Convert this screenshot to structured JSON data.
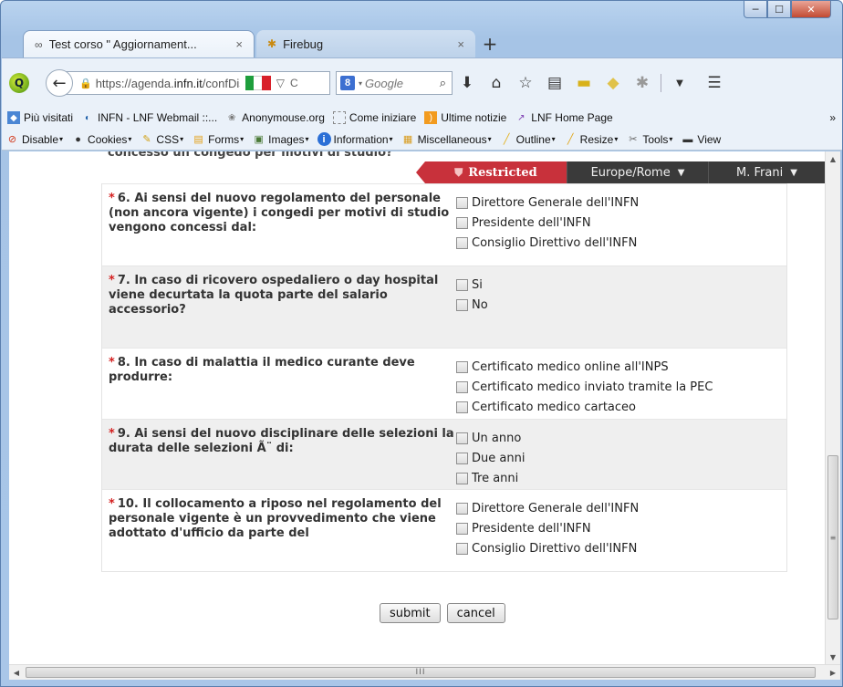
{
  "window": {
    "controls": {
      "minimize": "─",
      "maximize": "☐",
      "close": "✕"
    }
  },
  "tabs": [
    {
      "title": "Test corso \" Aggiornament...",
      "close": "×",
      "icon": "infinity-icon"
    },
    {
      "title": "Firebug",
      "close": "×",
      "icon": "firebug-icon"
    }
  ],
  "new_tab": "+",
  "navbar": {
    "url_prefix": "https://agenda.",
    "url_domain": "infn.it",
    "url_suffix": "/confDispla",
    "flag_colors": [
      "#1e9e3c",
      "#ffffff",
      "#d8202a"
    ],
    "search_engine": "8",
    "search_placeholder": "Google",
    "search_glyph": "⌕",
    "back": "←"
  },
  "bookmarks": [
    {
      "label": "Più visitati",
      "icon": "most-visited-icon"
    },
    {
      "label": "INFN - LNF Webmail ::...",
      "icon": "webmail-icon"
    },
    {
      "label": "Anonymouse.org",
      "icon": "anonymouse-icon"
    },
    {
      "label": "Come iniziare",
      "icon": "page-icon"
    },
    {
      "label": "Ultime notizie",
      "icon": "rss-icon"
    },
    {
      "label": "LNF Home Page",
      "icon": "lnf-icon"
    }
  ],
  "bookmarks_more": "»",
  "devbar": [
    {
      "label": "Disable",
      "color": "#d23a1d",
      "glyph": "⊘"
    },
    {
      "label": "Cookies",
      "color": "#333333",
      "glyph": "●"
    },
    {
      "label": "CSS",
      "color": "#e2b21c",
      "glyph": "✎"
    },
    {
      "label": "Forms",
      "color": "#e3a018",
      "glyph": "▤"
    },
    {
      "label": "Images",
      "color": "#4a7a37",
      "glyph": "▣"
    },
    {
      "label": "Information",
      "color": "#2b6fd6",
      "glyph": "i"
    },
    {
      "label": "Miscellaneous",
      "color": "#d89a1b",
      "glyph": "▦"
    },
    {
      "label": "Outline",
      "color": "#e3b11c",
      "glyph": "╱"
    },
    {
      "label": "Resize",
      "color": "#e0a61a",
      "glyph": "╱"
    },
    {
      "label": "Tools",
      "color": "#666666",
      "glyph": "✂"
    },
    {
      "label": "View",
      "color": "#333333",
      "glyph": "▬"
    }
  ],
  "page": {
    "cut_text": "concesso un congedo per motivi di studio?",
    "restricted": "Restricted",
    "timezone": "Europe/Rome",
    "user": "M. Frani",
    "questions": [
      {
        "text": "6. Ai sensi del nuovo regolamento del personale (non ancora vigente) i congedi per motivi di studio vengono concessi dal:",
        "options": [
          "Direttore Generale dell'INFN",
          "Presidente dell'INFN",
          "Consiglio Direttivo dell'INFN"
        ]
      },
      {
        "text": "7. In caso di ricovero ospedaliero o day hospital viene decurtata la quota parte del salario accessorio?",
        "options": [
          "Si",
          "No"
        ]
      },
      {
        "text": "8. In caso di malattia il medico curante deve produrre:",
        "options": [
          "Certificato medico online all'INPS",
          "Certificato medico inviato tramite la PEC",
          "Certificato medico cartaceo"
        ]
      },
      {
        "text": "9. Ai sensi del nuovo disciplinare delle selezioni la durata delle selezioni Ã¨ di:",
        "options": [
          "Un anno",
          "Due anni",
          "Tre anni"
        ]
      },
      {
        "text": "10. Il collocamento a riposo nel regolamento del personale vigente è un provvedimento che viene adottato d'ufficio da parte del",
        "options": [
          "Direttore Generale dell'INFN",
          "Presidente dell'INFN",
          "Consiglio Direttivo dell'INFN"
        ]
      }
    ],
    "submit_label": "submit",
    "cancel_label": "cancel"
  },
  "scrollbars": {
    "up": "▲",
    "down": "▼",
    "left": "◀",
    "right": "▶",
    "v_grip": "≡",
    "h_grip": "III"
  }
}
